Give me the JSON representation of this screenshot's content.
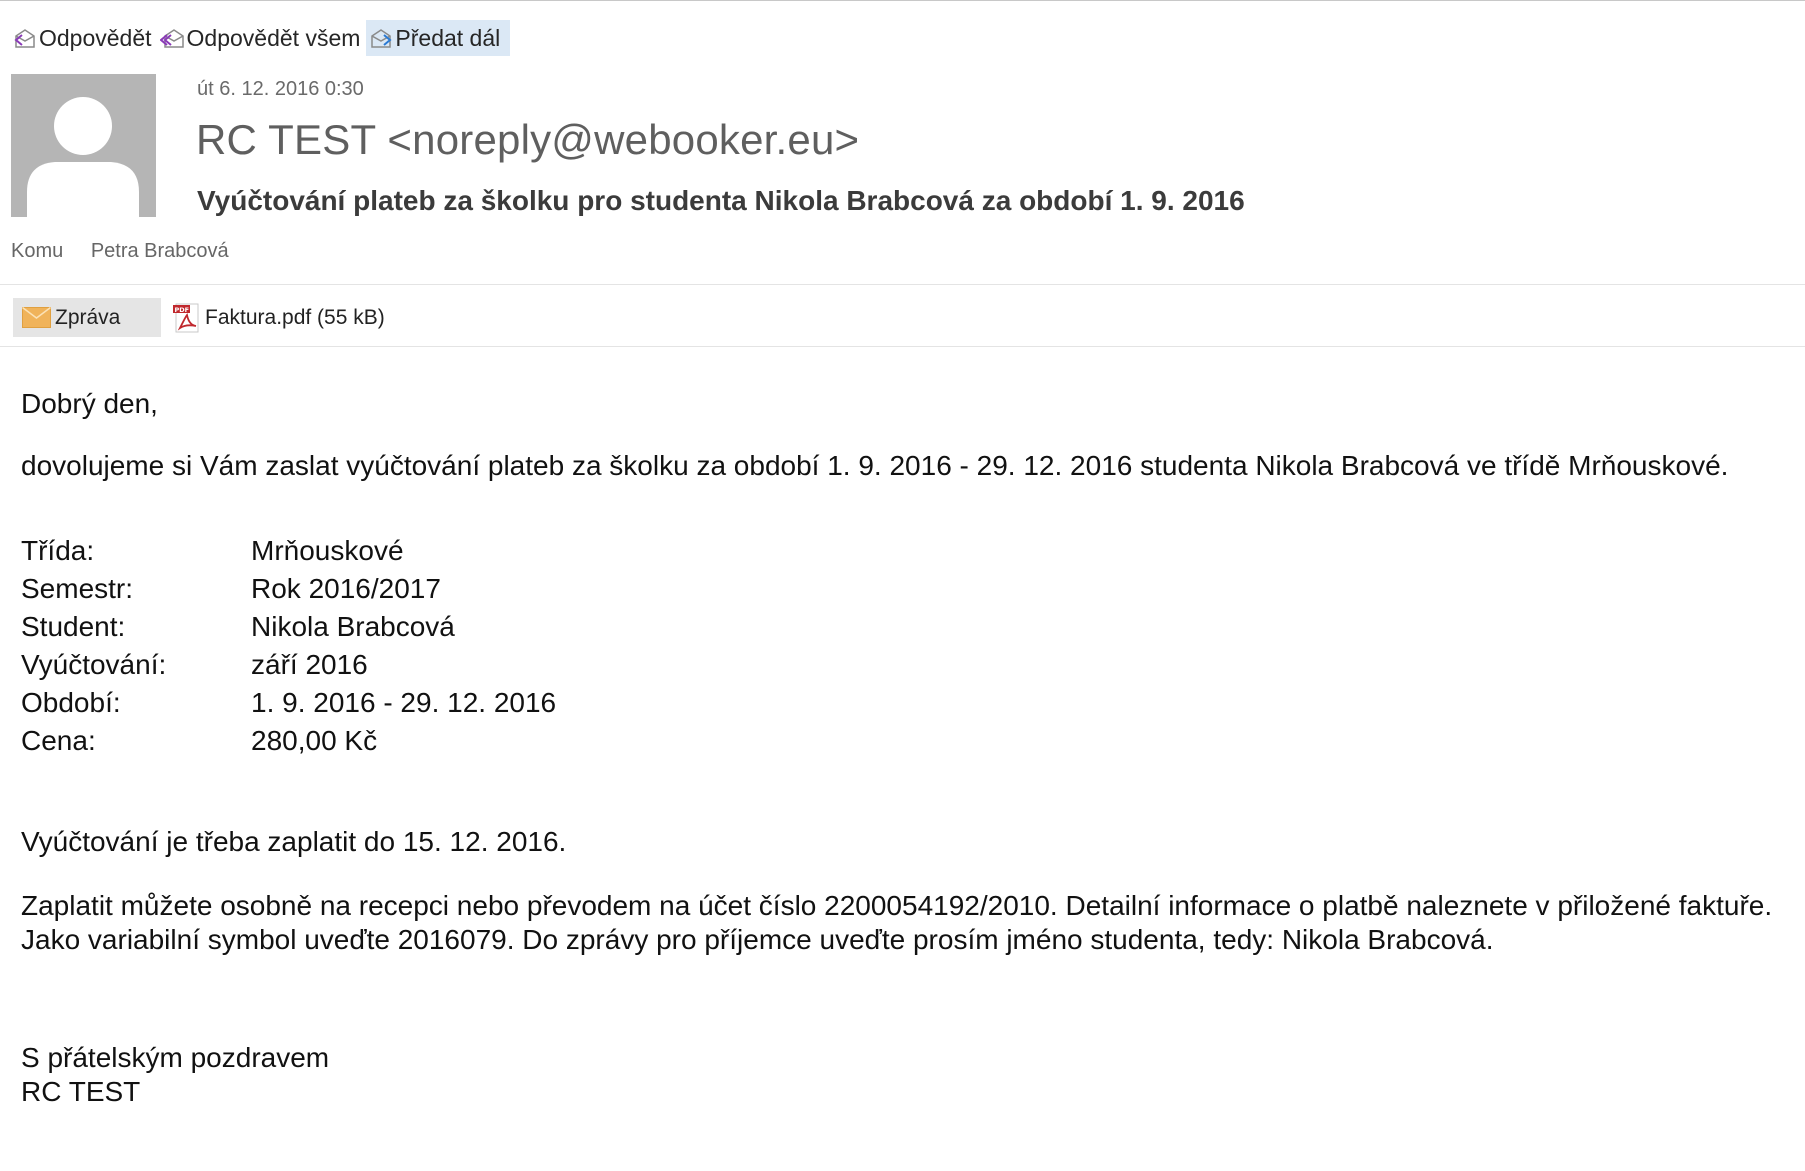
{
  "toolbar": {
    "reply": "Odpovědět",
    "reply_all": "Odpovědět všem",
    "forward": "Předat dál"
  },
  "header": {
    "date": "út 6. 12. 2016 0:30",
    "sender": "RC TEST <noreply@webooker.eu>",
    "subject": "Vyúčtování plateb za školku pro studenta Nikola  Brabcová za období 1. 9. 2016",
    "to_label": "Komu",
    "to_name": "Petra Brabcová"
  },
  "attachments": {
    "message_label": "Zpráva",
    "file_label": "Faktura.pdf (55 kB)"
  },
  "body": {
    "greeting": "Dobrý den,",
    "intro": "dovolujeme si Vám zaslat vyúčtování plateb za školku za období 1. 9. 2016 - 29. 12. 2016 studenta Nikola Brabcová ve třídě Mrňouskové.",
    "details": [
      {
        "label": "Třída:",
        "value": "Mrňouskové"
      },
      {
        "label": "Semestr:",
        "value": "Rok 2016/2017"
      },
      {
        "label": "Student:",
        "value": "Nikola Brabcová"
      },
      {
        "label": "Vyúčtování:",
        "value": "září 2016"
      },
      {
        "label": "Období:",
        "value": "1. 9. 2016 - 29. 12. 2016"
      },
      {
        "label": "Cena:",
        "value": "280,00 Kč"
      }
    ],
    "due": "Vyúčtování je třeba zaplatit do 15. 12. 2016.",
    "payment_line1": "Zaplatit můžete osobně na recepci nebo převodem na účet číslo 2200054192/2010. Detailní informace o platbě naleznete v přiložené faktuře.",
    "payment_line2": "Jako variabilní symbol uveďte 2016079. Do zprávy pro příjemce uveďte prosím jméno studenta, tedy: Nikola Brabcová.",
    "closing": "S přátelským pozdravem",
    "signature": "RC TEST"
  },
  "colors": {
    "forward_highlight": "#dbe8f5",
    "avatar_bg": "#b5b5b5",
    "pdf_red": "#c0282d",
    "envelope_orange": "#f0b35a"
  }
}
